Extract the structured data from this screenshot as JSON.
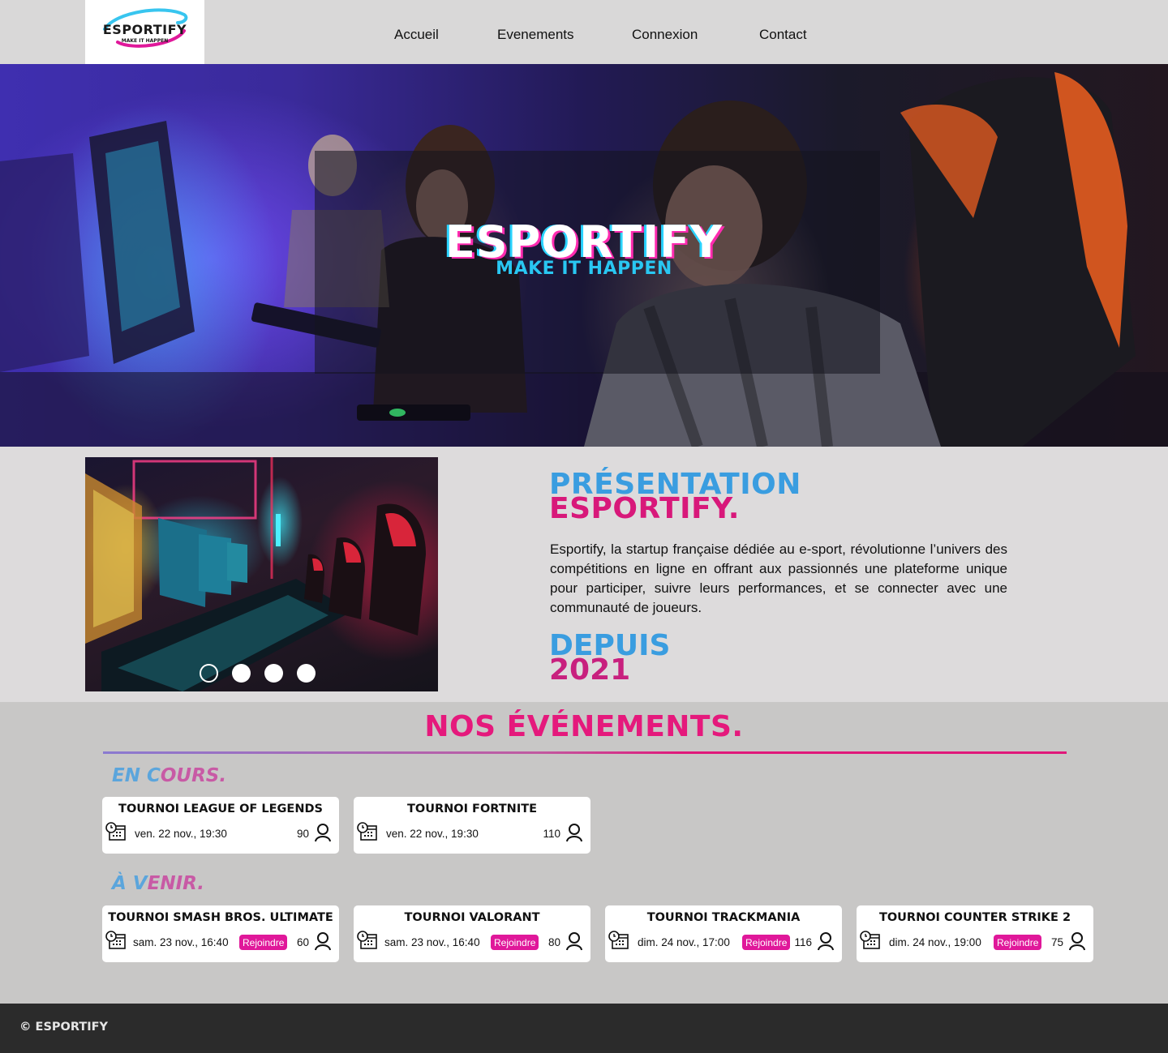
{
  "header": {
    "logo": {
      "word": "ESPORTIFY",
      "tagline": "MAKE IT HAPPEN"
    },
    "nav": [
      {
        "label": "Accueil"
      },
      {
        "label": "Evenements"
      },
      {
        "label": "Connexion"
      },
      {
        "label": "Contact"
      }
    ]
  },
  "hero": {
    "title": "ESPORTIFY",
    "subtitle": "MAKE IT HAPPEN"
  },
  "presentation": {
    "title_line1": "PRÉSENTATION",
    "title_line2": "ESPORTIFY.",
    "text": "Esportify, la startup française dédiée au e-sport, révolutionne l’univers des compétitions en ligne en offrant aux passionnés une plateforme unique pour participer, suivre leurs performances, et se connecter avec une communauté de joueurs.",
    "since_label": "DEPUIS",
    "since_year": "2021",
    "slider": {
      "slide_count": 4,
      "active_index": 0
    }
  },
  "events": {
    "title": "NOS ÉVÉNEMENTS.",
    "ongoing": {
      "label_a": "EN C",
      "label_b": "OURS.",
      "items": [
        {
          "title": "TOURNOI LEAGUE OF LEGENDS",
          "date": "ven. 22 nov., 19:30",
          "count": "90"
        },
        {
          "title": "TOURNOI FORTNITE",
          "date": "ven. 22 nov., 19:30",
          "count": "110"
        }
      ]
    },
    "upcoming": {
      "label_a": "À V",
      "label_b": "ENIR.",
      "join_label": "Rejoindre",
      "items": [
        {
          "title": "TOURNOI SMASH BROS. ULTIMATE",
          "date": "sam. 23 nov., 16:40",
          "count": "60"
        },
        {
          "title": "TOURNOI VALORANT",
          "date": "sam. 23 nov., 16:40",
          "count": "80"
        },
        {
          "title": "TOURNOI TRACKMANIA",
          "date": "dim. 24 nov., 17:00",
          "count": "116"
        },
        {
          "title": "TOURNOI COUNTER STRIKE 2",
          "date": "dim. 24 nov., 19:00",
          "count": "75"
        }
      ]
    }
  },
  "footer": {
    "copyright": "© ESPORTIFY"
  },
  "colors": {
    "pink": "#e5197c",
    "blue": "#3a9de0",
    "join": "#e0189a",
    "footer_bg": "#2b2b2b"
  },
  "icons": [
    "calendar-clock-icon",
    "user-icon"
  ]
}
